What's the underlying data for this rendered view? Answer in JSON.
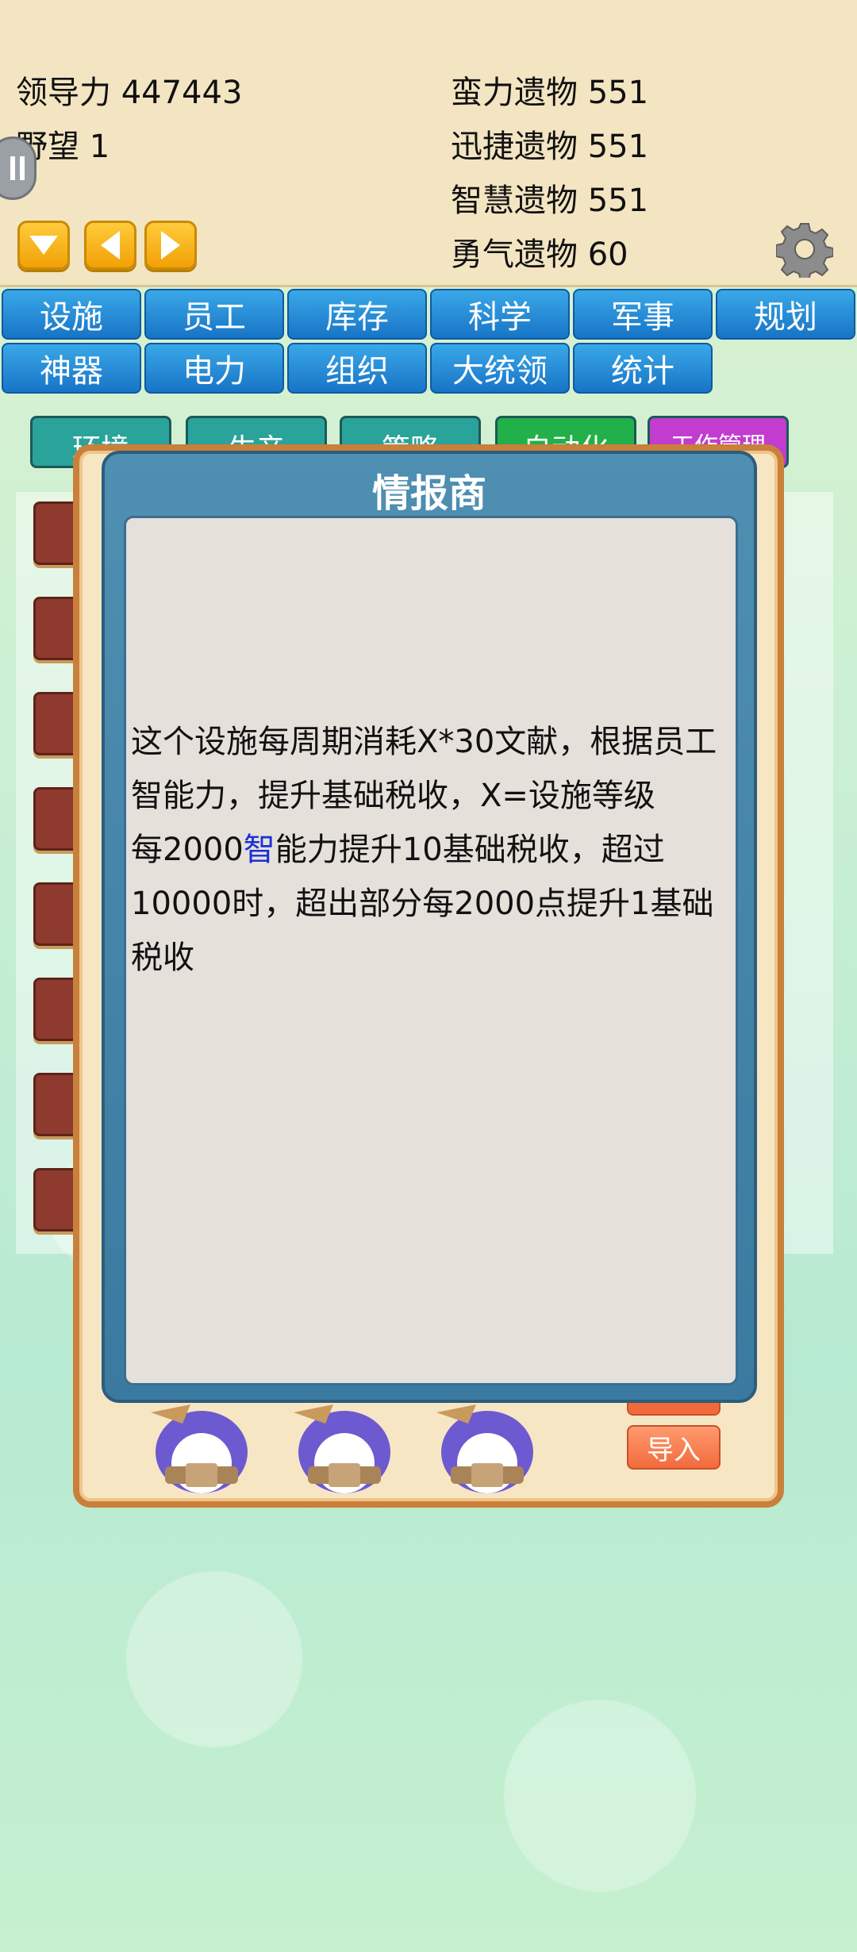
{
  "stats": {
    "leadership": "领导力 447443",
    "ambition": "野望 1",
    "relic_strength": "蛮力遗物 551",
    "relic_agility": "迅捷遗物 551",
    "relic_wisdom": "智慧遗物 551",
    "relic_courage": "勇气遗物 60"
  },
  "icons": {
    "down": "down-arrow-icon",
    "left": "left-arrow-icon",
    "right": "right-arrow-icon",
    "settings": "gear-icon",
    "side_handle": "pause-icon"
  },
  "main_tabs": [
    {
      "label": "设施"
    },
    {
      "label": "员工"
    },
    {
      "label": "库存"
    },
    {
      "label": "科学"
    },
    {
      "label": "军事"
    },
    {
      "label": "规划"
    },
    {
      "label": "神器"
    },
    {
      "label": "电力"
    },
    {
      "label": "组织"
    },
    {
      "label": "大统领"
    },
    {
      "label": "统计"
    }
  ],
  "sub_tabs": [
    {
      "label": "环境"
    },
    {
      "label": "生产"
    },
    {
      "label": "策略"
    },
    {
      "label": "自动化"
    },
    {
      "label": "工作管理"
    }
  ],
  "dialog": {
    "title": "情报商",
    "line1": "这个设施每周期消耗X*30文献，根据员工智能力，提升基础税收，X=设施等级",
    "line2_before": "每2000",
    "line2_highlight": "智",
    "line2_after": "能力提升10基础税收，超过10000时，超出部分每2000点提升1基础税收"
  },
  "buttons": {
    "import": "导入"
  },
  "colors": {
    "tab_blue": "#1874c6",
    "panel_beige": "#f3e5c2",
    "dialog_blue": "#3b7aa0",
    "highlight": "#1a2fd6",
    "import_orange": "#f26a3c"
  }
}
